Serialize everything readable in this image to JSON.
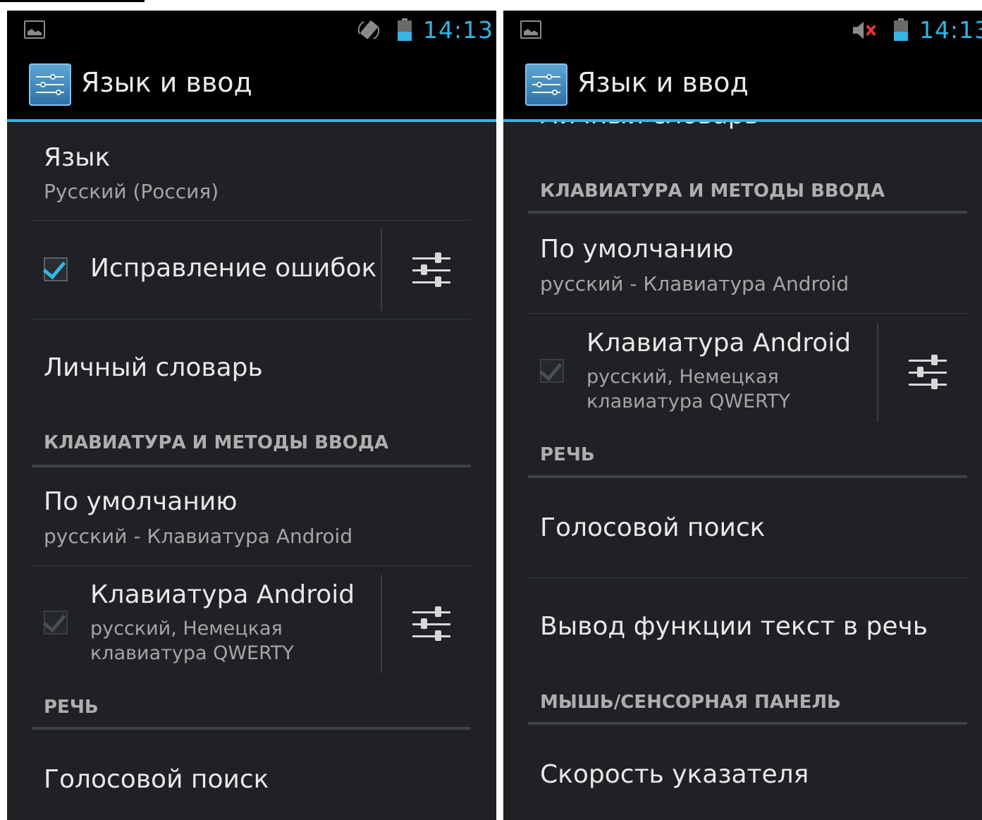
{
  "left": {
    "status": {
      "time": "14:13",
      "icons": [
        "gallery-notification-icon",
        "auto-rotate-icon",
        "battery-icon"
      ]
    },
    "action_bar": {
      "title": "Язык и ввод",
      "icon": "settings-app-icon"
    },
    "items": {
      "language": {
        "title": "Язык",
        "summary": "Русский (Россия)"
      },
      "spellcheck": {
        "title": "Исправление ошибок",
        "checked": true
      },
      "dictionary": {
        "title": "Личный словарь"
      },
      "section_keyboard": "КЛАВИАТУРА И МЕТОДЫ ВВОДА",
      "default": {
        "title": "По умолчанию",
        "summary": "русский - Клавиатура Android"
      },
      "android_kb": {
        "title": "Клавиатура Android",
        "summary_line1": "русский, Немецкая",
        "summary_line2": "клавиатура QWERTY",
        "checked": true,
        "enabled": false
      },
      "section_speech": "РЕЧЬ",
      "voice_search": {
        "title": "Голосовой поиск"
      }
    }
  },
  "right": {
    "status": {
      "time": "14:13",
      "icons": [
        "gallery-notification-icon",
        "muted-volume-icon",
        "battery-icon"
      ]
    },
    "action_bar": {
      "title": "Язык и ввод",
      "icon": "settings-app-icon"
    },
    "items": {
      "partial_dictionary": "Личный словарь",
      "section_keyboard": "КЛАВИАТУРА И МЕТОДЫ ВВОДА",
      "default": {
        "title": "По умолчанию",
        "summary": "русский - Клавиатура Android"
      },
      "android_kb": {
        "title": "Клавиатура Android",
        "summary_line1": "русский, Немецкая",
        "summary_line2": "клавиатура QWERTY",
        "checked": true,
        "enabled": false
      },
      "section_speech": "РЕЧЬ",
      "voice_search": {
        "title": "Голосовой поиск"
      },
      "tts": {
        "title": "Вывод функции текст в речь"
      },
      "section_mouse": "МЫШЬ/СЕНСОРНАЯ ПАНЕЛЬ",
      "pointer_speed": {
        "title": "Скорость указателя"
      }
    }
  },
  "colors": {
    "accent": "#33b5e5",
    "background": "#1f2124",
    "bar": "#000000"
  }
}
